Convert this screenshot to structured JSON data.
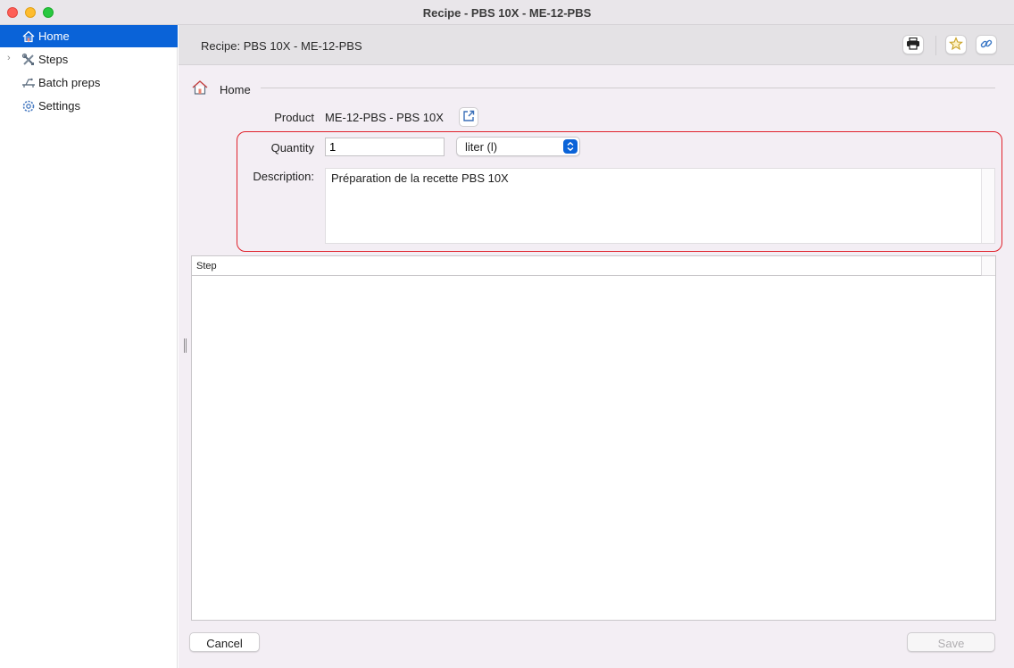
{
  "window": {
    "title": "Recipe - PBS 10X - ME-12-PBS"
  },
  "sidebar": {
    "items": [
      {
        "label": "Home",
        "icon": "home-icon",
        "selected": true
      },
      {
        "label": "Steps",
        "icon": "tools-icon",
        "expandable": true
      },
      {
        "label": "Batch preps",
        "icon": "batch-icon"
      },
      {
        "label": "Settings",
        "icon": "gear-icon"
      }
    ]
  },
  "header": {
    "title": "Recipe: PBS 10X - ME-12-PBS",
    "buttons": [
      "printer-icon",
      "star-icon",
      "link-icon"
    ]
  },
  "breadcrumb": {
    "label": "Home"
  },
  "form": {
    "product_label": "Product",
    "product_value": "ME-12-PBS - PBS 10X",
    "quantity_label": "Quantity",
    "quantity_value": "1",
    "unit_value": "liter (l)",
    "description_label": "Description:",
    "description_value": "Préparation de la recette PBS 10X"
  },
  "table": {
    "columns": [
      "Step"
    ],
    "rows": []
  },
  "footer": {
    "cancel_label": "Cancel",
    "save_label": "Save"
  },
  "colors": {
    "accent": "#0a63d8",
    "highlight": "#e0212b"
  }
}
